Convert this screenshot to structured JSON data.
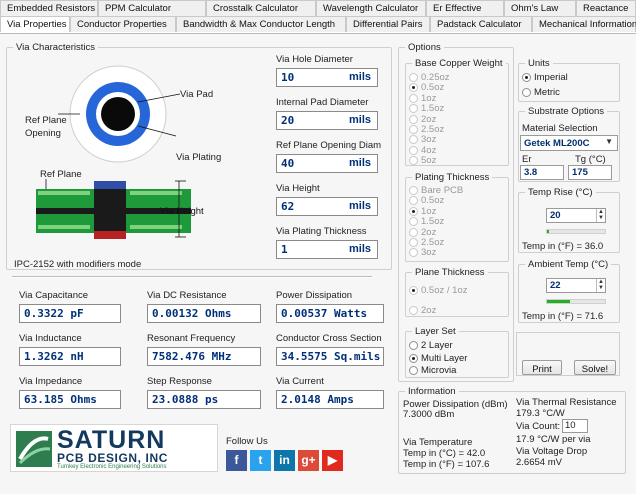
{
  "tabs_row1": [
    "Embedded Resistors",
    "PPM Calculator",
    "Crosstalk Calculator",
    "Wavelength Calculator",
    "Er Effective",
    "Ohm's Law",
    "Reactance"
  ],
  "tabs_row2": [
    "Via Properties",
    "Conductor Properties",
    "Bandwidth & Max Conductor Length",
    "Differential Pairs",
    "Padstack Calculator",
    "Mechanical Information"
  ],
  "active_tab": "Via Properties",
  "via_characteristics": {
    "title": "Via Characteristics",
    "diagram_labels": {
      "via_pad": "Via Pad",
      "ref_plane_opening": "Ref Plane\nOpening",
      "via_plating": "Via Plating",
      "ref_plane": "Ref Plane",
      "via_height": "Via Height"
    },
    "mode_text": "IPC-2152 with modifiers mode",
    "inputs": [
      {
        "label": "Via Hole Diameter",
        "value": "10",
        "unit": "mils"
      },
      {
        "label": "Internal Pad Diameter",
        "value": "20",
        "unit": "mils"
      },
      {
        "label": "Ref Plane Opening Diam",
        "value": "40",
        "unit": "mils"
      },
      {
        "label": "Via Height",
        "value": "62",
        "unit": "mils"
      },
      {
        "label": "Via Plating Thickness",
        "value": "1",
        "unit": "mils"
      }
    ],
    "results": [
      {
        "label": "Via Capacitance",
        "value": "0.3322 pF"
      },
      {
        "label": "Via DC Resistance",
        "value": "0.00132 Ohms"
      },
      {
        "label": "Power Dissipation",
        "value": "0.00537 Watts"
      },
      {
        "label": "Via Inductance",
        "value": "1.3262 nH"
      },
      {
        "label": "Resonant Frequency",
        "value": "7582.476 MHz"
      },
      {
        "label": "Conductor Cross Section",
        "value": "34.5575 Sq.mils"
      },
      {
        "label": "Via Impedance",
        "value": "63.185 Ohms"
      },
      {
        "label": "Step Response",
        "value": "23.0888 ps"
      },
      {
        "label": "Via Current",
        "value": "2.0148 Amps"
      }
    ]
  },
  "logo": {
    "line1": "SATURN",
    "line2": "PCB DESIGN, INC",
    "tagline": "Turnkey Electronic Engineering Solutions"
  },
  "follow_us": "Follow Us",
  "social_icons": [
    {
      "name": "facebook-icon",
      "glyph": "f",
      "color": "#3b5998"
    },
    {
      "name": "twitter-icon",
      "glyph": "t",
      "color": "#2aa3ef"
    },
    {
      "name": "linkedin-icon",
      "glyph": "in",
      "color": "#0e76a8"
    },
    {
      "name": "googleplus-icon",
      "glyph": "g+",
      "color": "#dc4a38"
    },
    {
      "name": "youtube-icon",
      "glyph": "▶",
      "color": "#e02a20"
    }
  ],
  "options": {
    "title": "Options",
    "base_copper": {
      "title": "Base Copper Weight",
      "items": [
        "0.25oz",
        "0.5oz",
        "1oz",
        "1.5oz",
        "2oz",
        "2.5oz",
        "3oz",
        "4oz",
        "5oz"
      ],
      "selected": "0.5oz"
    },
    "plating_thickness": {
      "title": "Plating Thickness",
      "items": [
        "Bare PCB",
        "0.5oz",
        "1oz",
        "1.5oz",
        "2oz",
        "2.5oz",
        "3oz"
      ],
      "selected": "1oz"
    },
    "plane_thickness": {
      "title": "Plane Thickness",
      "items": [
        "0.5oz / 1oz",
        "2oz"
      ],
      "selected": "0.5oz / 1oz"
    },
    "layer_set": {
      "title": "Layer Set",
      "items": [
        "2 Layer",
        "Multi Layer",
        "Microvia"
      ],
      "selected": "Multi Layer"
    }
  },
  "units": {
    "title": "Units",
    "items": [
      "Imperial",
      "Metric"
    ],
    "selected": "Imperial"
  },
  "substrate": {
    "title": "Substrate Options",
    "material_label": "Material Selection",
    "material": "Getek ML200C",
    "er_label": "Er",
    "er": "3.8",
    "tg_label": "Tg (°C)",
    "tg": "175"
  },
  "temp_rise": {
    "title": "Temp Rise (°C)",
    "value": "20",
    "fahrenheit_text": "Temp in (°F) = 36.0",
    "level": 0.04
  },
  "ambient_temp": {
    "title": "Ambient Temp (°C)",
    "value": "22",
    "fahrenheit_text": "Temp in (°F) = 71.6",
    "level": 0.4
  },
  "buttons": {
    "print": "Print",
    "solve": "Solve!"
  },
  "information": {
    "title": "Information",
    "power_label": "Power Dissipation (dBm)",
    "power_value": "7.3000 dBm",
    "via_temp_label": "Via Temperature",
    "temp_c": "Temp in (°C) = 42.0",
    "temp_f": "Temp in (°F) = 107.6",
    "thermal_label": "Via Thermal Resistance",
    "thermal_value": "179.3 °C/W",
    "via_count_label": "Via Count:",
    "via_count": "10",
    "per_via": "17.9 °C/W per via",
    "drop_label": "Via Voltage Drop",
    "drop_value": "2.6654 mV"
  },
  "colors": {
    "accent_blue": "#1f5ed6",
    "field_text": "#00307a",
    "board_green": "#1f9a3a"
  }
}
